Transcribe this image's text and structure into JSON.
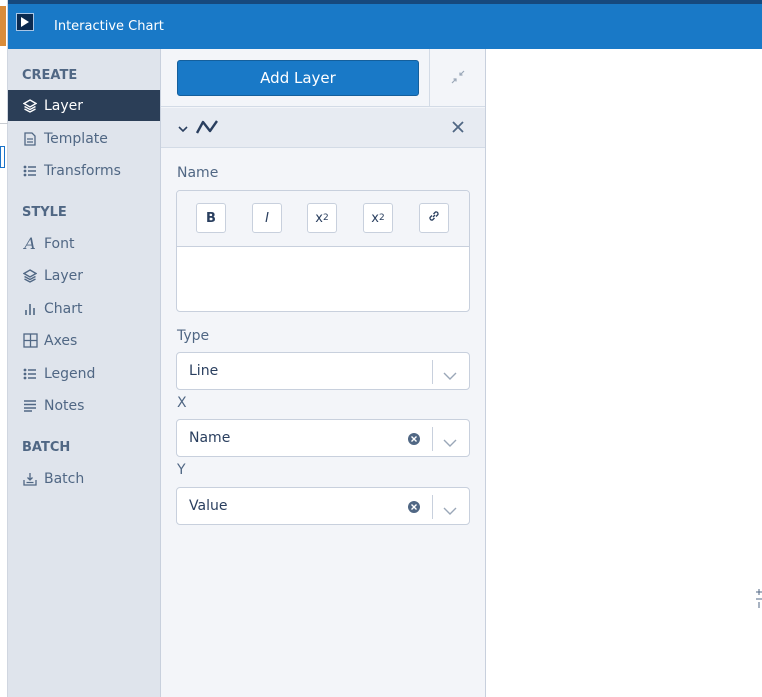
{
  "window": {
    "title": "Interactive Chart",
    "app_icon": "play-icon",
    "accent_color": "#1979c7"
  },
  "sidebar": {
    "sections": [
      {
        "title": "CREATE",
        "items": [
          {
            "label": "Layer",
            "icon": "layers-icon",
            "active": true
          },
          {
            "label": "Template",
            "icon": "template-icon",
            "active": false
          },
          {
            "label": "Transforms",
            "icon": "transforms-icon",
            "active": false
          }
        ]
      },
      {
        "title": "STYLE",
        "items": [
          {
            "label": "Font",
            "icon": "font-icon",
            "active": false
          },
          {
            "label": "Layer",
            "icon": "layers-icon",
            "active": false
          },
          {
            "label": "Chart",
            "icon": "chart-icon",
            "active": false
          },
          {
            "label": "Axes",
            "icon": "axes-icon",
            "active": false
          },
          {
            "label": "Legend",
            "icon": "legend-icon",
            "active": false
          },
          {
            "label": "Notes",
            "icon": "notes-icon",
            "active": false
          }
        ]
      },
      {
        "title": "BATCH",
        "items": [
          {
            "label": "Batch",
            "icon": "batch-icon",
            "active": false
          }
        ]
      }
    ],
    "active_color": "#2b3e57"
  },
  "panel": {
    "add_layer_label": "Add Layer",
    "collapse_icon": "collapse-icon",
    "trace": {
      "expand_icon": "chevron-down-icon",
      "type_icon": "line-trace-icon",
      "close_icon": "close-icon"
    },
    "name_field": {
      "label": "Name",
      "value": "",
      "toolbar": [
        "B",
        "I",
        "x2",
        "x2",
        "link"
      ]
    },
    "type_field": {
      "label": "Type",
      "value": "Line"
    },
    "x_field": {
      "label": "X",
      "value": "Name"
    },
    "y_field": {
      "label": "Y",
      "value": "Value"
    }
  }
}
